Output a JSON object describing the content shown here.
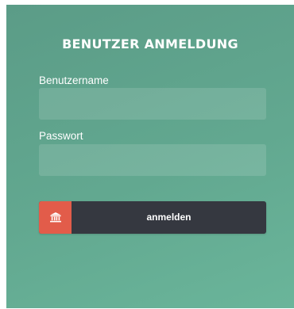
{
  "form": {
    "title": "BENUTZER ANMELDUNG",
    "username_label": "Benutzername",
    "username_value": "",
    "password_label": "Passwort",
    "password_value": "",
    "submit_label": "anmelden",
    "submit_icon": "bank-icon"
  },
  "colors": {
    "panel_gradient_start": "#5b9c87",
    "panel_gradient_end": "#6ab59a",
    "button_background": "#353840",
    "icon_background": "#e25c4a",
    "text": "#ffffff"
  }
}
